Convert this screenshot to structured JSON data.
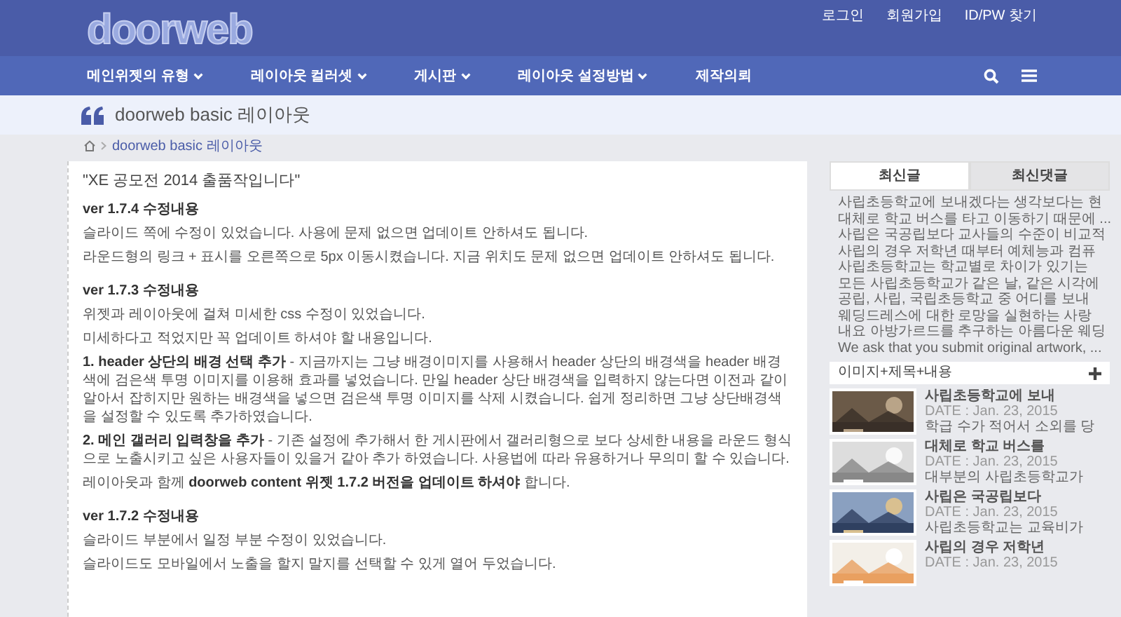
{
  "top_links": [
    "로그인",
    "회원가입",
    "ID/PW 찾기"
  ],
  "logo": "doorweb",
  "nav": [
    {
      "label": "메인위젯의 유형",
      "dropdown": true
    },
    {
      "label": "레이아웃 컬러셋",
      "dropdown": true
    },
    {
      "label": "게시판",
      "dropdown": true
    },
    {
      "label": "레이아웃 설정방법",
      "dropdown": true
    },
    {
      "label": "제작의뢰",
      "dropdown": false
    }
  ],
  "page_title": "doorweb basic 레이아웃",
  "breadcrumb": [
    "doorweb basic 레이아웃"
  ],
  "article": [
    {
      "kind": "title",
      "text": "\"XE 공모전 2014 출품작입니다\""
    },
    {
      "kind": "version",
      "text": "ver 1.7.4  수정내용"
    },
    {
      "kind": "para",
      "text": "슬라이드 쪽에 수정이 있었습니다. 사용에 문제 없으면 업데이트 안하셔도 됩니다."
    },
    {
      "kind": "para",
      "text": "라운드형의 링크 + 표시를 오른쪽으로 5px 이동시켰습니다. 지금 위치도 문제 없으면 업데이트 안하셔도 됩니다."
    },
    {
      "kind": "version",
      "text": "ver 1.7.3  수정내용"
    },
    {
      "kind": "para",
      "text": "위젯과 레이아웃에 걸쳐 미세한 css 수정이 있었습니다."
    },
    {
      "kind": "para",
      "text": "미세하다고 적었지만 꼭 업데이트 하셔야 할 내용입니다."
    },
    {
      "kind": "para",
      "text": "**1. header 상단의 배경 선택 추가** - 지금까지는 그냥 배경이미지를 사용해서 header 상단의 배경색을 header 배경색에 검은색 투명 이미지를 이용해 효과를 넣었습니다. 만일 header 상단 배경색을 입력하지 않는다면 이전과 같이 알아서 잡히지만 원하는 배경색을 넣으면 검은색 투명 이미지를 삭제 시켰습니다. 쉽게 정리하면 그냥 상단배경색을 설정할 수 있도록 추가하였습니다."
    },
    {
      "kind": "para",
      "text": "**2. 메인 갤러리 입력창을 추가** - 기존 설정에 추가해서 한 게시판에서 갤러리형으로 보다 상세한 내용을 라운드 형식으로 노출시키고 싶은 사용자들이 있을거 같아 추가 하였습니다.  사용법에 따라 유용하거나 무의미 할 수 있습니다."
    },
    {
      "kind": "para",
      "text": "레이아웃과 함께 **doorweb content 위젯 1.7.2 버전을 업데이트 하셔야** 합니다."
    },
    {
      "kind": "version",
      "text": "ver 1.7.2  수정내용"
    },
    {
      "kind": "para",
      "text": "슬라이드 부분에서 일정 부분 수정이 있었습니다."
    },
    {
      "kind": "para",
      "text": "슬라이드도 모바일에서 노출을 할지 말지를 선택할 수 있게 열어 두었습니다."
    }
  ],
  "sidebar": {
    "tabs": [
      {
        "label": "최신글",
        "selected": true
      },
      {
        "label": "최신댓글",
        "selected": false
      }
    ],
    "recent": [
      "사립초등학교에 보내겠다는 생각보다는 현",
      "대체로 학교 버스를 타고 이동하기 때문에 ...",
      "사립은 국공립보다 교사들의 수준이 비교적",
      "사립의 경우 저학년 때부터 예체능과 컴퓨",
      "사립초등학교는 학교별로 차이가 있기는",
      "모든 사립초등학교가 같은 날, 같은 시각에",
      "공립, 사립, 국립초등학교 중 어디를 보내",
      "웨딩드레스에 대한 로망을 실현하는 사랑",
      "내요 아방가르드를 추구하는 아름다운 웨딩",
      "We ask that you submit original artwork, ..."
    ],
    "widget": {
      "title": "이미지+제목+내용",
      "items": [
        {
          "title": "사립초등학교에 보내",
          "date": "DATE : Jan. 23, 2015",
          "excerpt": "학급 수가 적어서 소외를 당"
        },
        {
          "title": "대체로 학교 버스를",
          "date": "DATE : Jan. 23, 2015",
          "excerpt": "대부분의 사립초등학교가"
        },
        {
          "title": "사립은 국공립보다",
          "date": "DATE : Jan. 23, 2015",
          "excerpt": "사립초등학교는 교육비가"
        },
        {
          "title": "사립의 경우 저학년",
          "date": "DATE : Jan. 23, 2015"
        }
      ]
    }
  }
}
